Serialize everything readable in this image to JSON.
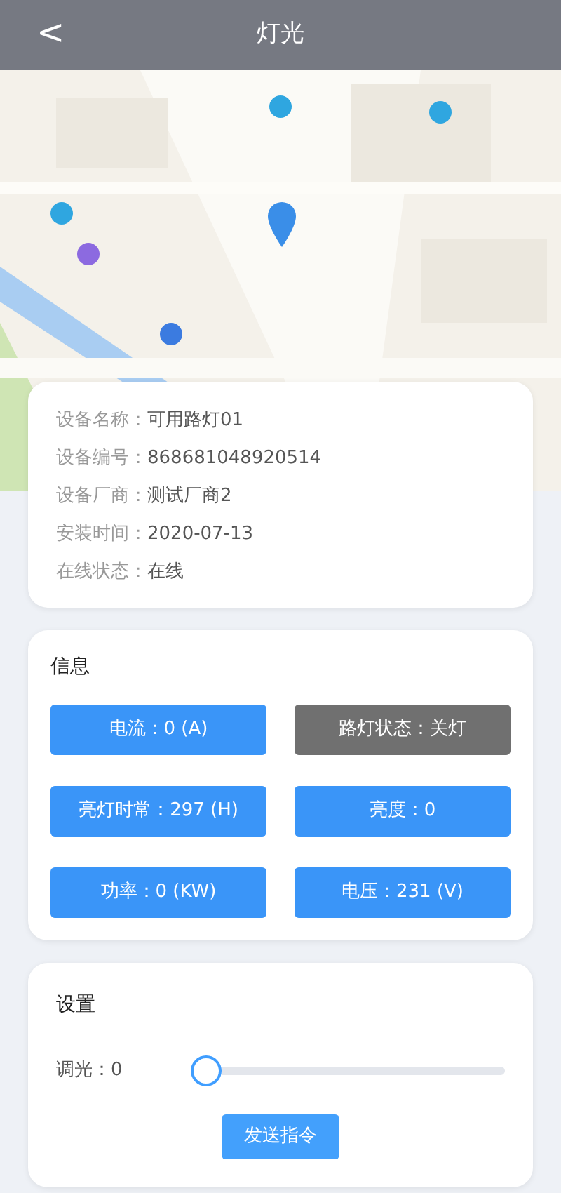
{
  "header": {
    "back": "<",
    "title": "灯光"
  },
  "device": [
    {
      "label": "设备名称：",
      "value": "可用路灯01"
    },
    {
      "label": "设备编号：",
      "value": "868681048920514"
    },
    {
      "label": "设备厂商：",
      "value": "测试厂商2"
    },
    {
      "label": "安装时间：",
      "value": "2020-07-13"
    },
    {
      "label": "在线状态：",
      "value": "在线"
    }
  ],
  "info": {
    "title": "信息",
    "cells": [
      {
        "text": "电流：0 (A)",
        "color": "#3a95f8"
      },
      {
        "text": "路灯状态：关灯",
        "color": "#707070"
      },
      {
        "text": "亮灯时常：297 (H)",
        "color": "#3a95f8"
      },
      {
        "text": "亮度：0",
        "color": "#3a95f8"
      },
      {
        "text": "功率：0 (KW)",
        "color": "#3a95f8"
      },
      {
        "text": "电压：231 (V)",
        "color": "#3a95f8"
      }
    ]
  },
  "settings": {
    "title": "设置",
    "dimmer": {
      "label": "调光：0",
      "level": 0
    },
    "button": "发送指令"
  }
}
